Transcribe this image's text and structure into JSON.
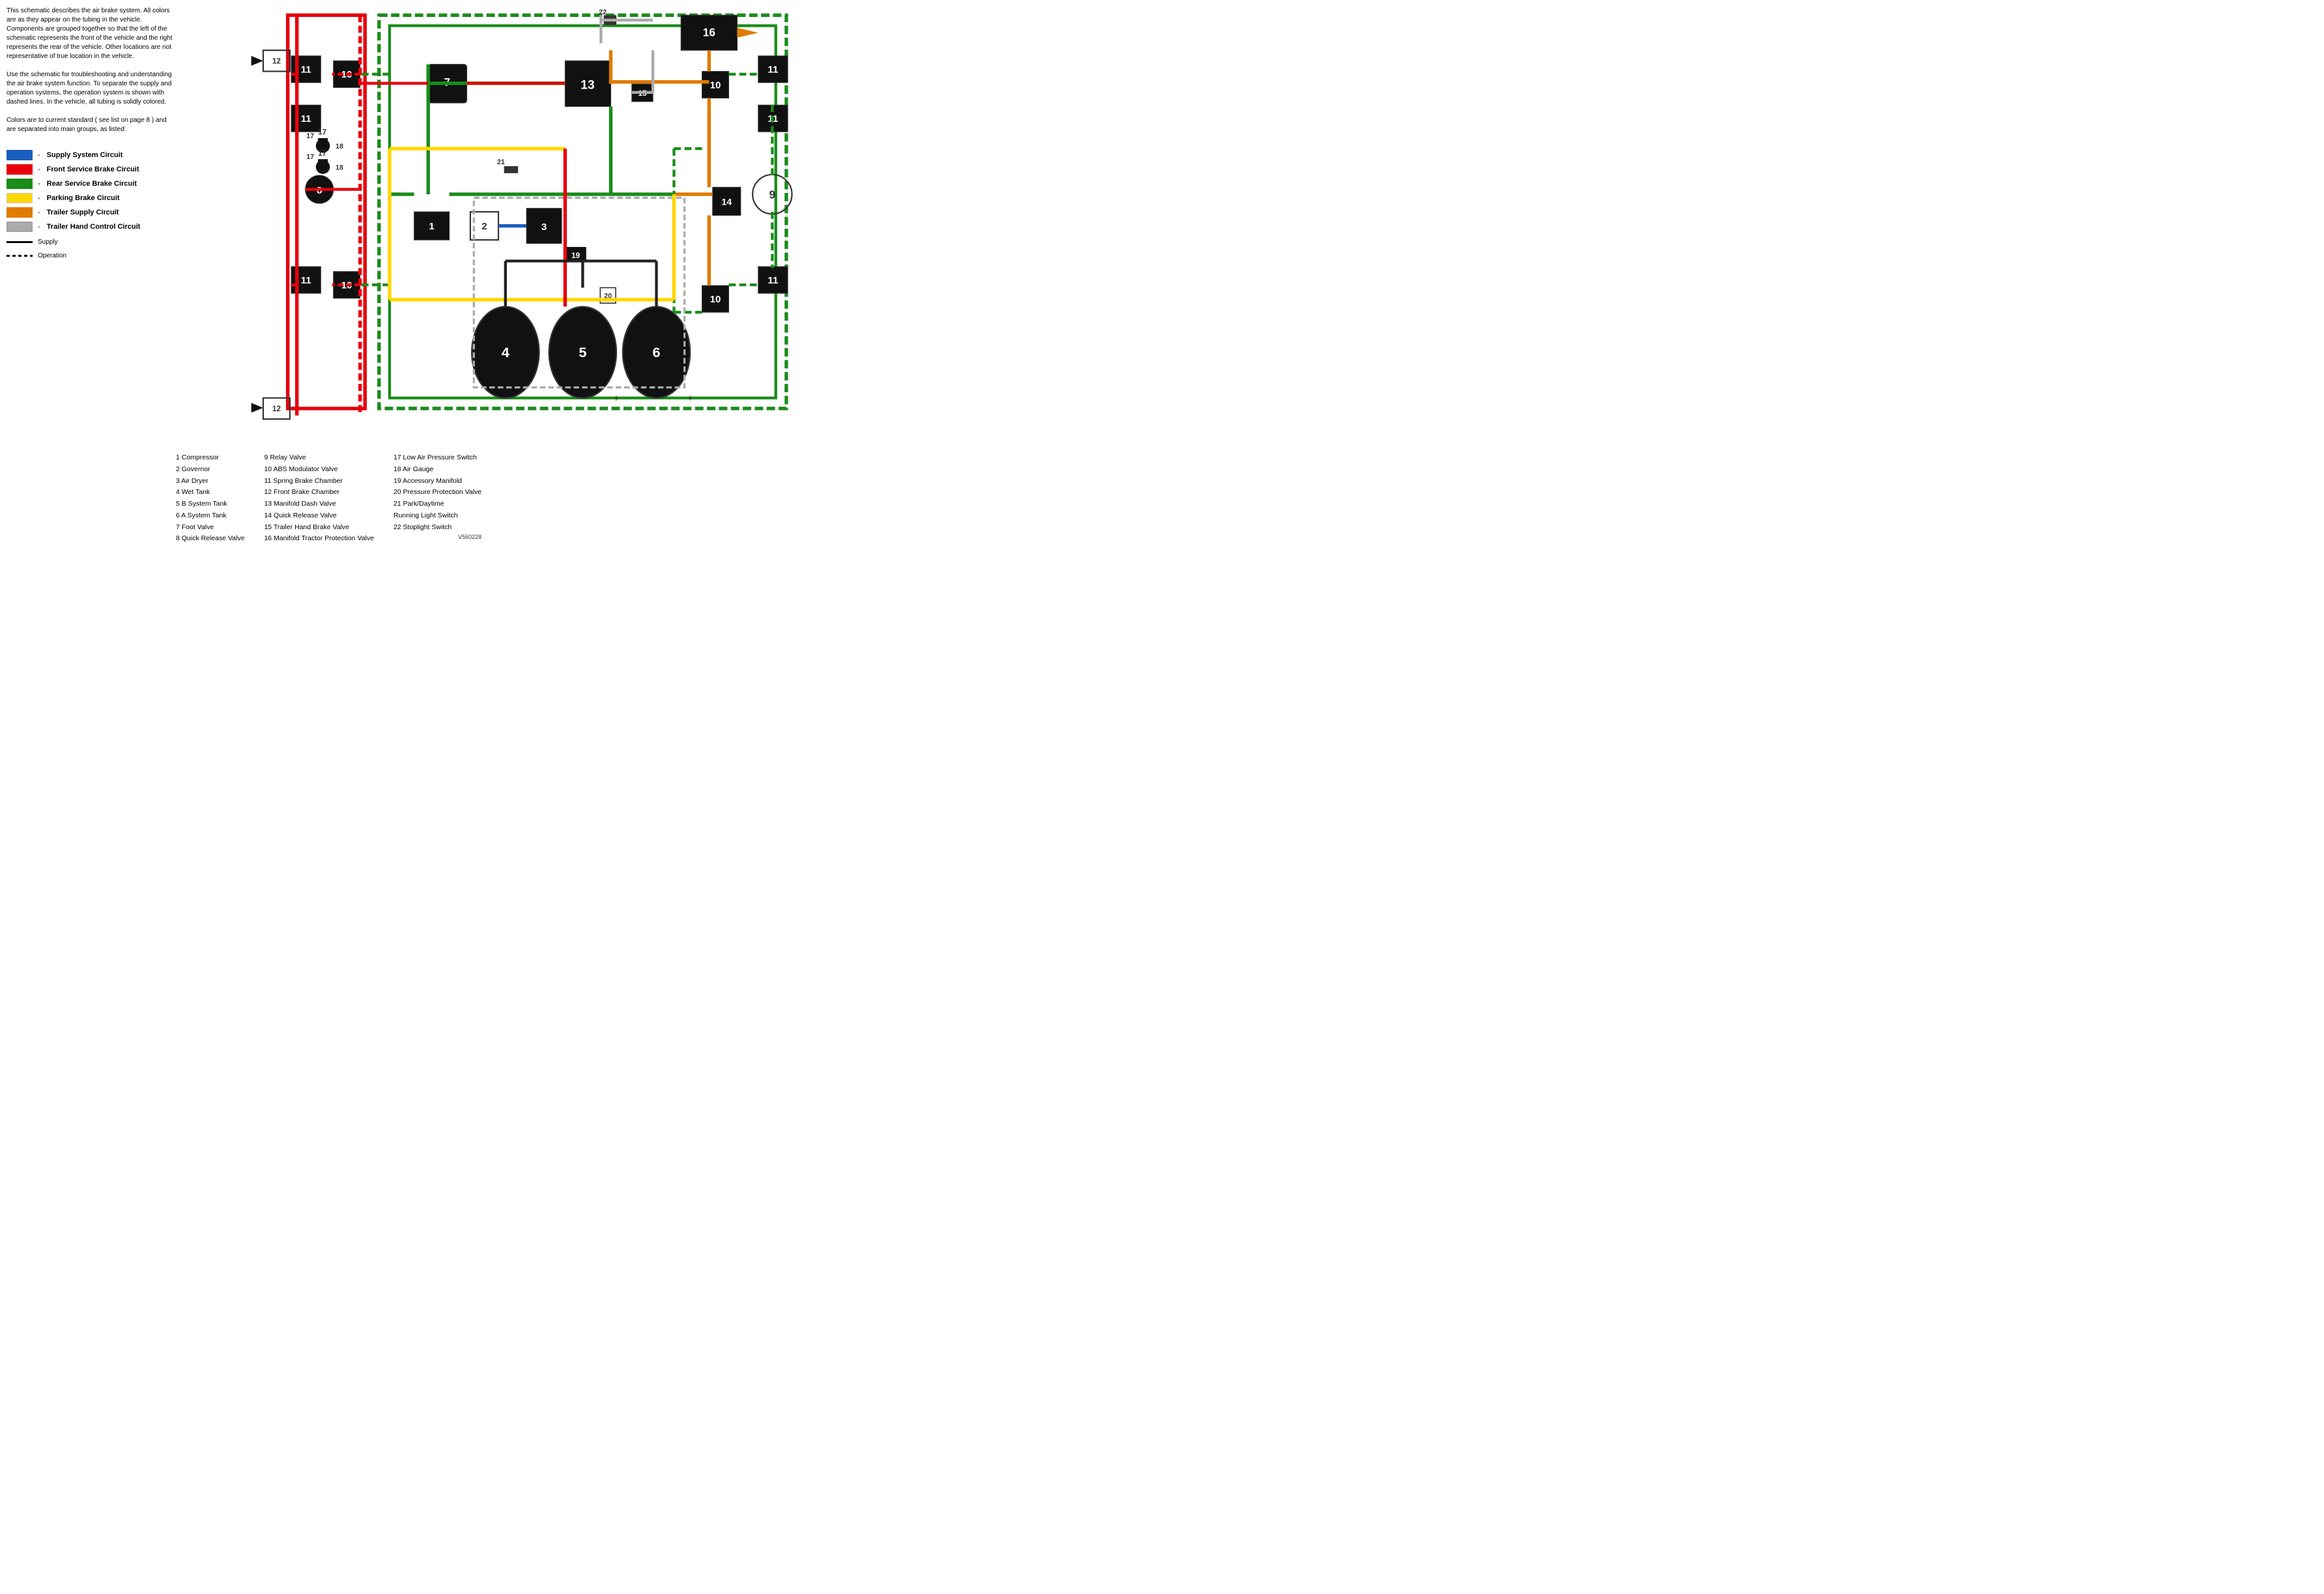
{
  "description": [
    "This schematic describes the air brake system. All colors are as they appear on the tubing in the vehicle. Components are grouped together so that the left of the schematic represents the front of the vehicle and the right represents the rear of the vehicle. Other locations are not representative of true location in the vehicle.",
    "Use the schematic for troubleshooting and understanding the air brake system function. To separate the supply and operation systems, the operation system is shown with dashed lines. In the vehicle, all tubing is solidly colored.",
    "Colors are to current standard ( see list on page 8 ) and are separated into main groups, as listed:"
  ],
  "legend": [
    {
      "color": "#1a5fbd",
      "label": "Supply System Circuit",
      "solid": true
    },
    {
      "color": "#e8000d",
      "label": "Front Service Brake Circuit",
      "solid": true
    },
    {
      "color": "#1a8c1a",
      "label": "Rear Service Brake Circuit",
      "solid": true
    },
    {
      "color": "#ffd700",
      "label": "Parking Brake Circuit",
      "solid": true
    },
    {
      "color": "#e07b00",
      "label": "Trailer Supply Circuit",
      "solid": true
    },
    {
      "color": "#c0c0c0",
      "label": "Trailer Hand Control Circuit",
      "solid": true
    }
  ],
  "line_types": [
    {
      "type": "supply",
      "label": "Supply"
    },
    {
      "type": "operation",
      "label": "Operation"
    }
  ],
  "parts": {
    "col1": [
      "1  Compressor",
      "2  Governor",
      "3  Air Dryer",
      "4  Wet Tank",
      "5  B System Tank",
      "6  A System Tank",
      "7  Foot Valve",
      "8  Quick Release Valve"
    ],
    "col2": [
      "9  Relay Valve",
      "10 ABS Modulator Valve",
      "11 Spring Brake Chamber",
      "12 Front Brake Chamber",
      "13 Manifold Dash Valve",
      "14 Quick Release Valve",
      "15 Trailer Hand Brake Valve",
      "16 Manifold Tractor Protection Valve"
    ],
    "col3": [
      "17 Low Air Pressure Switch",
      "18 Air Gauge",
      "19 Accessory Manifold",
      "20 Pressure Protection Valve",
      "21 Park/Daytime",
      "    Running Light Switch",
      "22 Stoplight Switch"
    ]
  },
  "version": "V560228"
}
